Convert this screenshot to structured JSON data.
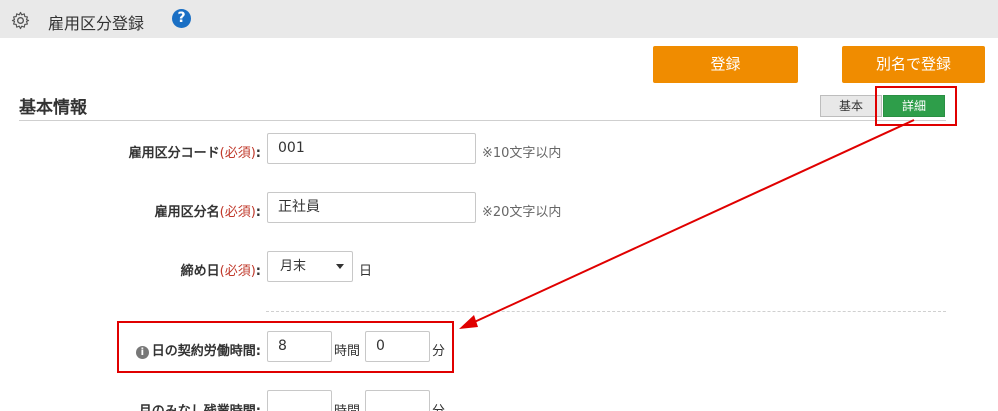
{
  "header": {
    "title": "雇用区分登録",
    "help_icon_glyph": "?"
  },
  "toolbar": {
    "register_label": "登録",
    "register_alias_label": "別名で登録"
  },
  "section": {
    "title": "基本情報"
  },
  "view_toggle": {
    "basic_label": "基本",
    "detail_label": "詳細",
    "selected": "詳細"
  },
  "form": {
    "code": {
      "label": "雇用区分コード",
      "required": "(必須)",
      "colon": ":",
      "value": "001",
      "hint": "※10文字以内"
    },
    "name": {
      "label": "雇用区分名",
      "required": "(必須)",
      "colon": ":",
      "value": "正社員",
      "hint": "※20文字以内"
    },
    "closing_day": {
      "label": "締め日",
      "required": "(必須)",
      "colon": ":",
      "selected": "月末",
      "unit": "日"
    },
    "daily_hours": {
      "label": "日の契約労働時間:",
      "hours_value": "8",
      "hours_unit": "時間",
      "minutes_value": "0",
      "minutes_unit": "分"
    },
    "monthly_overtime": {
      "label": "月のみなし残業時間:",
      "hours_value": "",
      "hours_unit": "時間",
      "minutes_value": "",
      "minutes_unit": "分"
    }
  },
  "colors": {
    "accent_orange": "#f08c00",
    "toggle_green": "#2e9e4a",
    "annotation_red": "#e00000",
    "required_red": "#c0392b"
  },
  "icons": {
    "settings": "gear-icon",
    "help": "help-icon",
    "info": "info-icon",
    "select_caret": "chevron-down-icon"
  }
}
